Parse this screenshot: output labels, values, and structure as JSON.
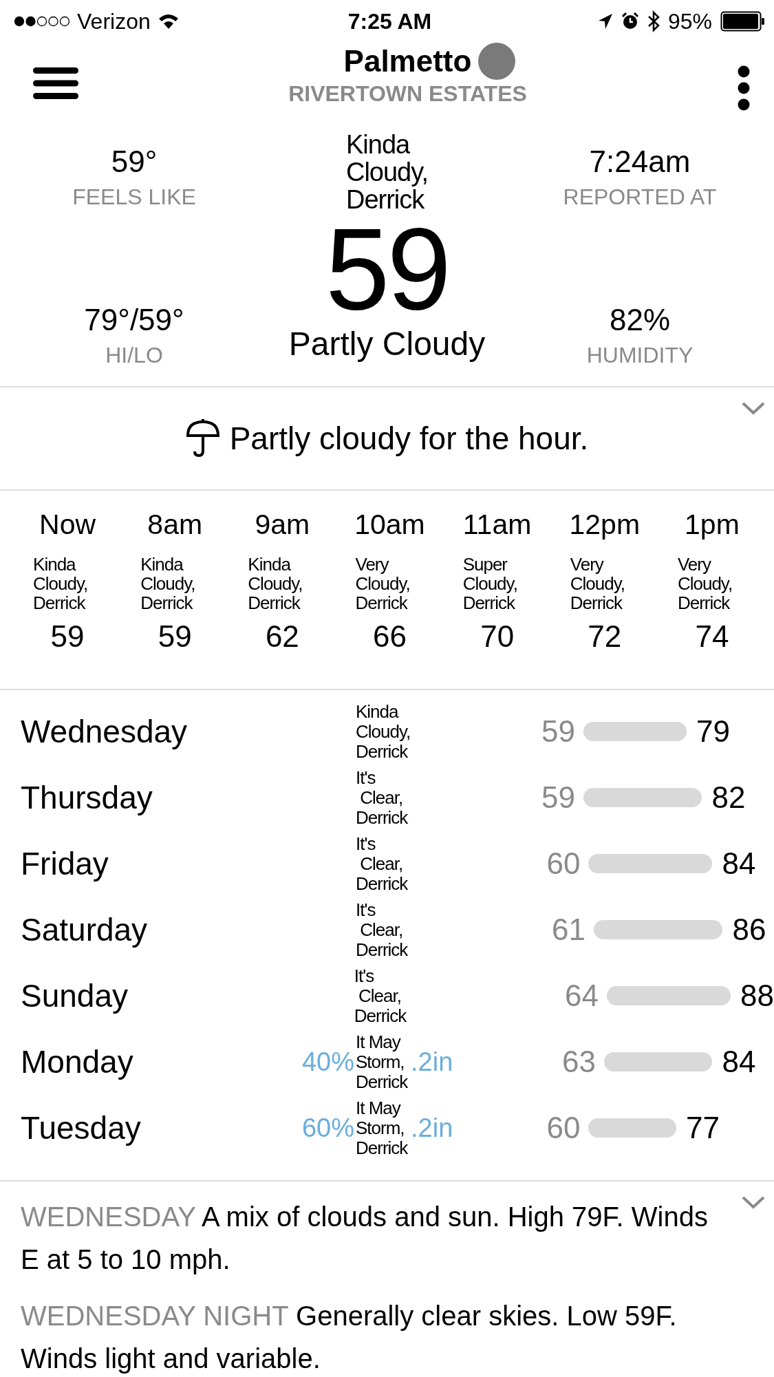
{
  "status_bar": {
    "carrier": "Verizon",
    "time": "7:25 AM",
    "battery": "95%"
  },
  "header": {
    "title": "Palmetto",
    "subtitle": "RIVERTOWN ESTATES"
  },
  "current": {
    "feels_like": "59°",
    "feels_like_label": "FEELS LIKE",
    "reported_at": "7:24am",
    "reported_at_label": "REPORTED AT",
    "hi_lo": "79°/59°",
    "hi_lo_label": "HI/LO",
    "humidity": "82%",
    "humidity_label": "HUMIDITY",
    "condition_quip": "Kinda\nCloudy,\nDerrick",
    "temperature": "59",
    "condition": "Partly Cloudy"
  },
  "summary": {
    "text": "Partly cloudy for the hour."
  },
  "hourly": [
    {
      "time": "Now",
      "quip": "Kinda\nCloudy,\nDerrick",
      "temp": "59"
    },
    {
      "time": "8am",
      "quip": "Kinda\nCloudy,\nDerrick",
      "temp": "59"
    },
    {
      "time": "9am",
      "quip": "Kinda\nCloudy,\nDerrick",
      "temp": "62"
    },
    {
      "time": "10am",
      "quip": "Very\nCloudy,\nDerrick",
      "temp": "66"
    },
    {
      "time": "11am",
      "quip": "Super\nCloudy,\nDerrick",
      "temp": "70"
    },
    {
      "time": "12pm",
      "quip": "Very\nCloudy,\nDerrick",
      "temp": "72"
    },
    {
      "time": "1pm",
      "quip": "Very\nCloudy,\nDerrick",
      "temp": "74"
    }
  ],
  "daily": [
    {
      "day": "Wednesday",
      "quip": "Kinda\nCloudy,\nDerrick",
      "low": "59",
      "high": "79"
    },
    {
      "day": "Thursday",
      "quip": "It's\n Clear,\nDerrick",
      "low": "59",
      "high": "82"
    },
    {
      "day": "Friday",
      "quip": "It's\n Clear,\nDerrick",
      "low": "60",
      "high": "84"
    },
    {
      "day": "Saturday",
      "quip": "It's\n Clear,\nDerrick",
      "low": "61",
      "high": "86"
    },
    {
      "day": "Sunday",
      "quip": "It's\n Clear,\nDerrick",
      "low": "64",
      "high": "88"
    },
    {
      "day": "Monday",
      "precip_chance": "40%",
      "quip": "It May\nStorm,\nDerrick",
      "precip_amount": ".2in",
      "low": "63",
      "high": "84"
    },
    {
      "day": "Tuesday",
      "precip_chance": "60%",
      "quip": "It May\nStorm,\nDerrick",
      "precip_amount": ".2in",
      "low": "60",
      "high": "77"
    }
  ],
  "forecast": [
    {
      "label": "WEDNESDAY",
      "text": "A mix of clouds and sun. High 79F. Winds E at 5 to 10 mph."
    },
    {
      "label": "WEDNESDAY NIGHT",
      "text": "Generally clear skies. Low 59F. Winds light and variable."
    }
  ]
}
